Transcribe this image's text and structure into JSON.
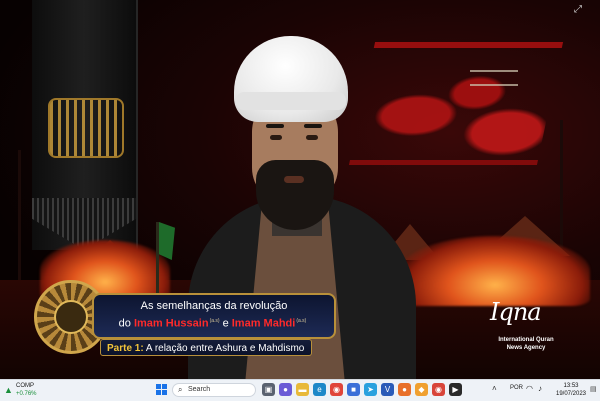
{
  "video": {
    "lower_third": {
      "line1": "As semelhanças da revolução",
      "line2_prefix": "do",
      "name1": "Imam Hussain",
      "honorific1": "(a.s)",
      "connector": "e",
      "name2": "Imam Mahdi",
      "honorific2": "(a.s)",
      "part_label": "Parte 1:",
      "part_text": "A relação entre Ashura e Mahdismo"
    },
    "logo": {
      "text": "Iqna",
      "line1": "International Quran",
      "line2": "News Agency"
    },
    "colors": {
      "accent_red": "#ff2a2a",
      "part_gold": "#f2c43a",
      "lower_third_bg": "#1d2a55",
      "border_gold": "#b8903a"
    }
  },
  "window": {
    "maximize_icon": "maximize-icon"
  },
  "taskbar": {
    "weather": {
      "title": "COMP",
      "change": "+0.76%"
    },
    "search": {
      "placeholder": "Search"
    },
    "apps": [
      {
        "name": "task-view",
        "icon": "task-view-icon"
      },
      {
        "name": "chat",
        "icon": "chat-icon"
      },
      {
        "name": "file-explorer",
        "icon": "folder-icon"
      },
      {
        "name": "edge",
        "icon": "edge-icon"
      },
      {
        "name": "chrome",
        "icon": "chrome-icon"
      },
      {
        "name": "store",
        "icon": "store-icon"
      },
      {
        "name": "telegram",
        "icon": "telegram-icon"
      },
      {
        "name": "vpn",
        "icon": "vpn-icon"
      },
      {
        "name": "firefox",
        "icon": "firefox-icon"
      },
      {
        "name": "app-orange",
        "icon": "app-icon"
      },
      {
        "name": "app-chrome-2",
        "icon": "chrome-icon"
      },
      {
        "name": "media-player",
        "icon": "play-icon"
      }
    ],
    "tray": {
      "language": "POR",
      "time": "13:53",
      "date": "19/07/2023"
    }
  }
}
